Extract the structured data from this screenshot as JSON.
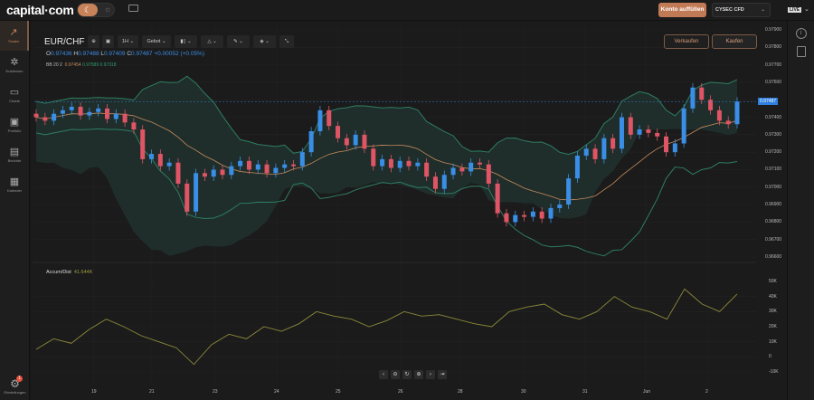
{
  "header": {
    "logo": "capital·com",
    "theme_dark_icon": "moon-icon",
    "theme_light_icon": "sun-icon",
    "mail_icon": "mail-icon",
    "fund_button": "Konto auffüllen",
    "account_select": "CYSEC CFD",
    "live_badge": "LIVE"
  },
  "sidebar": {
    "items": [
      {
        "label": "Traden",
        "icon": "trend-icon",
        "active": true
      },
      {
        "label": "Entdecken",
        "icon": "discover-icon"
      },
      {
        "label": "Charts",
        "icon": "chart-icon"
      },
      {
        "label": "Portfolio",
        "icon": "briefcase-icon"
      },
      {
        "label": "Berichte",
        "icon": "report-icon"
      },
      {
        "label": "Kalender",
        "icon": "calendar-icon"
      }
    ],
    "settings": {
      "label": "Einstellungen",
      "badge": "1"
    }
  },
  "toolbar": {
    "symbol": "EUR/CHF",
    "interval": "1H",
    "price_type": "Gebot",
    "sell": "Verkaufen",
    "buy": "Kaufen"
  },
  "ohlc": {
    "o_label": "O",
    "o": "0.97436",
    "h_label": "H",
    "h": "0.97488",
    "l_label": "L",
    "l": "0.97409",
    "c_label": "C",
    "c": "0.97487",
    "change": "+0.00052 (+0.05%)"
  },
  "bb": {
    "label": "BB 20 2",
    "mid": "0.97454",
    "upper": "0.97589",
    "lower": "0.97318"
  },
  "colors": {
    "up": "#3a8ee6",
    "down": "#e05565",
    "bb_band": "#2e7d62",
    "bb_mid": "#c78b5e",
    "ad_line": "#8d8a3a",
    "accent": "#c07a55"
  },
  "price_axis": [
    "0.97900",
    "0.97800",
    "0.97700",
    "0.97600",
    "0.97400",
    "0.97300",
    "0.97200",
    "0.97100",
    "0.97000",
    "0.96900",
    "0.96800",
    "0.96700",
    "0.96600"
  ],
  "last_price": "0.97487",
  "ad": {
    "label": "Accum/Dist",
    "value": "41.644K",
    "axis": [
      "50K",
      "40K",
      "30K",
      "20K",
      "10K",
      "0",
      "-10K"
    ]
  },
  "x_axis": [
    "19",
    "21",
    "23",
    "24",
    "25",
    "26",
    "28",
    "30",
    "31",
    "Jun",
    "2"
  ],
  "chart_data": {
    "type": "candlestick",
    "ylim": [
      0.966,
      0.979
    ],
    "closes": [
      0.974,
      0.9738,
      0.9742,
      0.9744,
      0.9746,
      0.9741,
      0.9743,
      0.9745,
      0.9739,
      0.9742,
      0.9737,
      0.9733,
      0.9716,
      0.9719,
      0.9712,
      0.9714,
      0.9702,
      0.9686,
      0.9708,
      0.9706,
      0.971,
      0.9707,
      0.9712,
      0.9715,
      0.971,
      0.9713,
      0.9708,
      0.9711,
      0.9713,
      0.9712,
      0.972,
      0.9732,
      0.9744,
      0.9735,
      0.9728,
      0.9724,
      0.973,
      0.9722,
      0.9712,
      0.9716,
      0.9711,
      0.9715,
      0.9712,
      0.9714,
      0.9706,
      0.9699,
      0.9707,
      0.9711,
      0.9709,
      0.9714,
      0.9713,
      0.9702,
      0.9685,
      0.968,
      0.9684,
      0.9683,
      0.9686,
      0.9682,
      0.9688,
      0.969,
      0.9705,
      0.9718,
      0.9722,
      0.9716,
      0.9728,
      0.9722,
      0.974,
      0.973,
      0.9733,
      0.9731,
      0.9729,
      0.972,
      0.9725,
      0.9745,
      0.9757,
      0.975,
      0.9744,
      0.9738,
      0.9736,
      0.9749
    ],
    "ad_ylim": [
      -10000,
      50000
    ],
    "ad_values": [
      5000,
      12000,
      9000,
      18000,
      25000,
      20000,
      14000,
      10000,
      6000,
      -5000,
      8000,
      15000,
      12000,
      20000,
      17000,
      22000,
      30000,
      27000,
      25000,
      20000,
      24000,
      30000,
      27000,
      28000,
      25000,
      22000,
      20000,
      30000,
      33000,
      35000,
      28000,
      25000,
      30000,
      40000,
      33000,
      30000,
      25000,
      45000,
      35000,
      30000,
      41644
    ]
  }
}
